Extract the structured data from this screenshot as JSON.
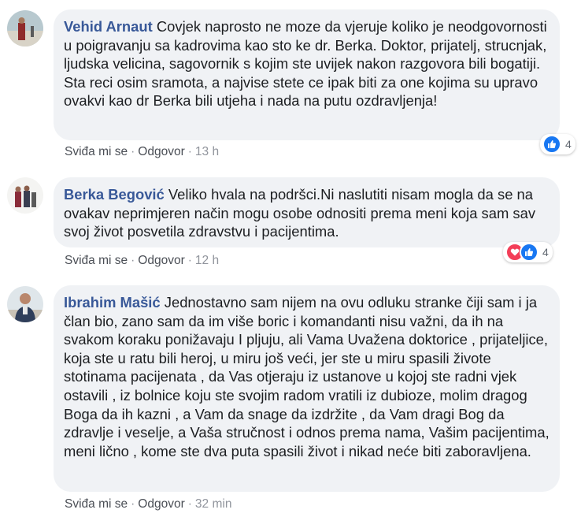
{
  "comments": [
    {
      "author": "Vehid Arnaut",
      "text": "Covjek naprosto ne moze da vjeruje koliko je neodgovornosti u poigravanju sa kadrovima kao sto ke dr. Berka. Doktor, prijatelj, strucnjak, ljudska velicina, sagovornik s kojim ste uvijek nakon razgovora bili bogatiji. Sta reci osim sramota, a najvise stete ce ipak biti za one kojima su upravo ovakvi kao dr Berka bili utjeha i nada na putu ozdravljenja!",
      "like_label": "Sviđa mi se",
      "reply_label": "Odgovor",
      "time": "13 h",
      "reactions": [
        "like-icon"
      ],
      "reaction_count": "4"
    },
    {
      "author": "Berka Begović",
      "text": "Veliko hvala na podršci.Ni naslutiti nisam mogla da se na ovakav neprimjeren način mogu osobe odnositi prema meni koja sam sav svoj život posvetila zdravstvu i pacijentima.",
      "like_label": "Sviđa mi se",
      "reply_label": "Odgovor",
      "time": "12 h",
      "reactions": [
        "love-icon",
        "like-icon"
      ],
      "reaction_count": "4"
    },
    {
      "author": "Ibrahim Mašić",
      "text": "Jednostavno sam nijem na ovu odluku stranke čiji sam i ja član bio, zano sam da im više boric i komandanti nisu važni, da ih na svakom koraku ponižavaju I pljuju, ali Vama Uvažena doktorice , prijateljice, koja ste u ratu bili heroj, u miru još veći, jer ste u miru spasili živote stotinama pacijenata , da Vas otjeraju iz ustanove u kojoj ste radni vjek ostavili , iz bolnice koju ste svojim radom vratili iz dubioze, molim dragog Boga da ih kazni , a Vam da snage da izdržite , da Vam dragi Bog da zdravlje i veselje, a Vaša stručnost i odnos prema nama, Vašim pacijentima, meni lično , kome ste dva puta spasili život i nikad neće biti zaboravljena.",
      "like_label": "Sviđa mi se",
      "reply_label": "Odgovor",
      "time": "32 min"
    }
  ],
  "separator": "·",
  "colors": {
    "author": "#385898",
    "bubble": "#f0f2f5",
    "like": "#1877f2",
    "love": "#f33e58"
  }
}
